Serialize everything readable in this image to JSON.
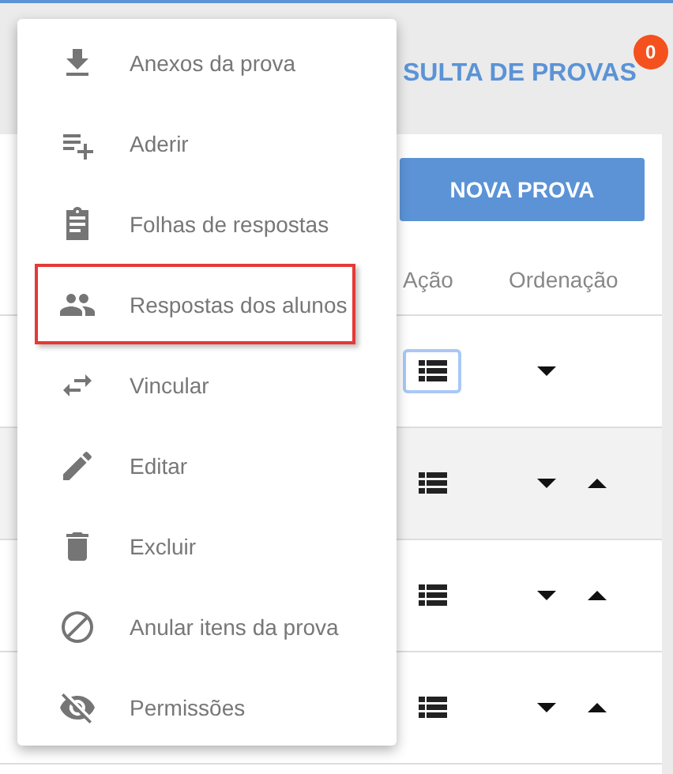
{
  "header": {
    "title": "SULTA DE PROVAS",
    "badge": "0"
  },
  "new_button": "NOVA PROVA",
  "table": {
    "columns": [
      "Ação",
      "Ordenação"
    ],
    "rows": [
      {
        "highlighted": false,
        "action_focused": true,
        "sort_down": true,
        "sort_up": false
      },
      {
        "highlighted": true,
        "action_focused": false,
        "sort_down": true,
        "sort_up": true
      },
      {
        "highlighted": false,
        "action_focused": false,
        "sort_down": true,
        "sort_up": true
      },
      {
        "highlighted": false,
        "action_focused": false,
        "sort_down": true,
        "sort_up": true
      }
    ]
  },
  "menu": {
    "items": [
      {
        "kind": "download",
        "label": "Anexos da prova",
        "selected": false
      },
      {
        "kind": "playlist-add",
        "label": "Aderir",
        "selected": false
      },
      {
        "kind": "clipboard",
        "label": "Folhas de respostas",
        "selected": false
      },
      {
        "kind": "people",
        "label": "Respostas dos alunos",
        "selected": true
      },
      {
        "kind": "swap",
        "label": "Vincular",
        "selected": false
      },
      {
        "kind": "pencil",
        "label": "Editar",
        "selected": false
      },
      {
        "kind": "trash",
        "label": "Excluir",
        "selected": false
      },
      {
        "kind": "block",
        "label": "Anular itens da prova",
        "selected": false
      },
      {
        "kind": "eye-off",
        "label": "Permissões",
        "selected": false
      }
    ]
  }
}
